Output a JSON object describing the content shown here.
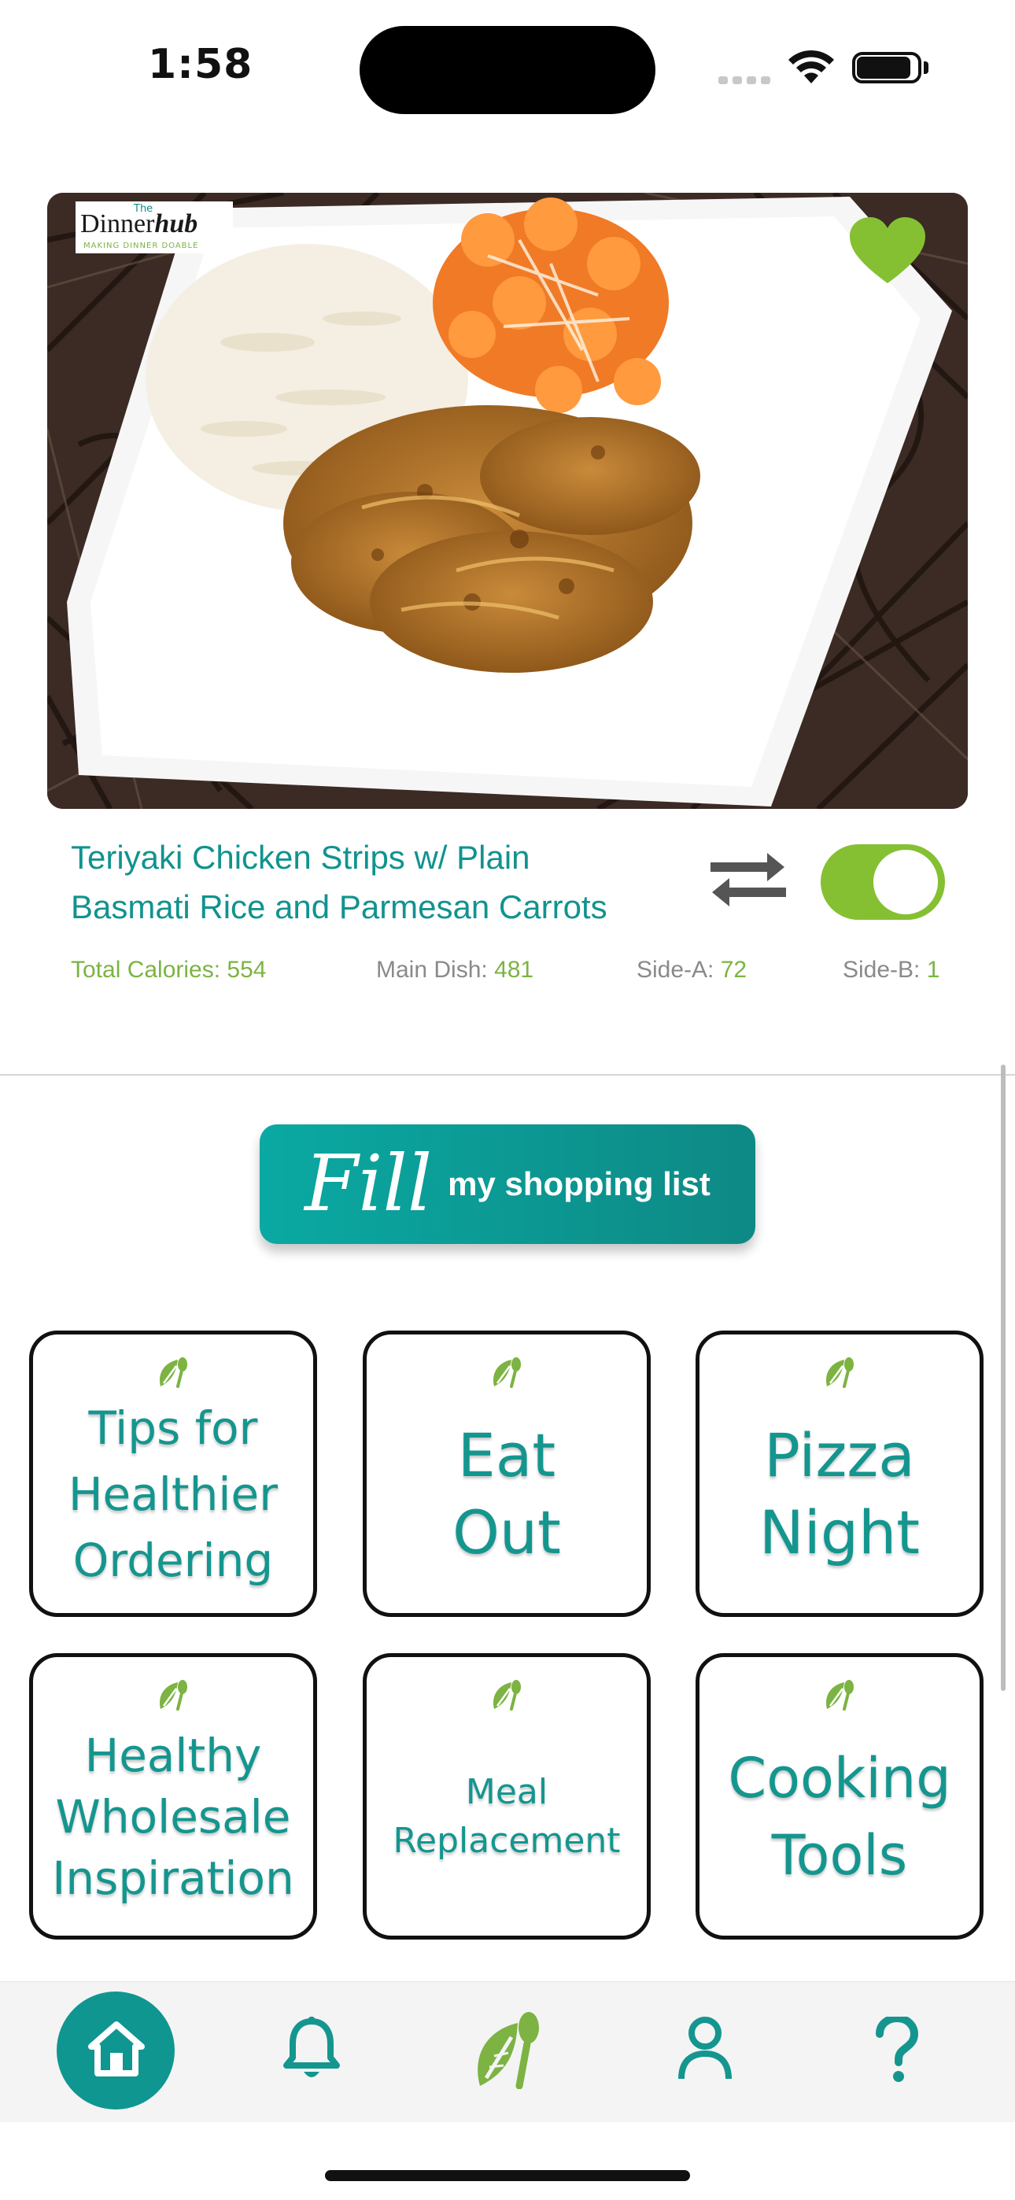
{
  "status_bar": {
    "time": "1:58"
  },
  "brand": {
    "the": "The",
    "name_part1": "Dinner",
    "name_part2": "hub",
    "tagline": "MAKING DINNER DOABLE"
  },
  "meal": {
    "title_line1": "Teriyaki Chicken Strips w/ Plain",
    "title_line2": "Basmati Rice and Parmesan Carrots",
    "favorited": true,
    "toggle_on": true,
    "stats": {
      "total_label": "Total Calories:",
      "total_value": "554",
      "main_label": "Main Dish:",
      "main_value": "481",
      "side_a_label": "Side-A:",
      "side_a_value": "72",
      "side_b_label": "Side-B:",
      "side_b_value": "1"
    }
  },
  "fill_button": {
    "script": "Fill",
    "rest": "my shopping list"
  },
  "tiles": [
    {
      "lines": [
        "Tips for",
        "Healthier",
        "Ordering"
      ]
    },
    {
      "lines": [
        "Eat",
        "Out"
      ]
    },
    {
      "lines": [
        "Pizza",
        "Night"
      ]
    },
    {
      "lines": [
        "Healthy",
        "Wholesale",
        "Inspiration"
      ]
    },
    {
      "lines": [
        "Meal",
        "Replacement"
      ]
    },
    {
      "lines": [
        "Cooking",
        "Tools"
      ]
    }
  ],
  "tab_bar": {
    "items": [
      {
        "icon": "home-icon",
        "active": true
      },
      {
        "icon": "bell-icon",
        "active": false
      },
      {
        "icon": "leaf-spoon-icon",
        "active": false
      },
      {
        "icon": "person-icon",
        "active": false
      },
      {
        "icon": "question-icon",
        "active": false
      }
    ]
  },
  "colors": {
    "teal": "#14968f",
    "green": "#85c032",
    "text_gray": "#8a8a8a"
  }
}
